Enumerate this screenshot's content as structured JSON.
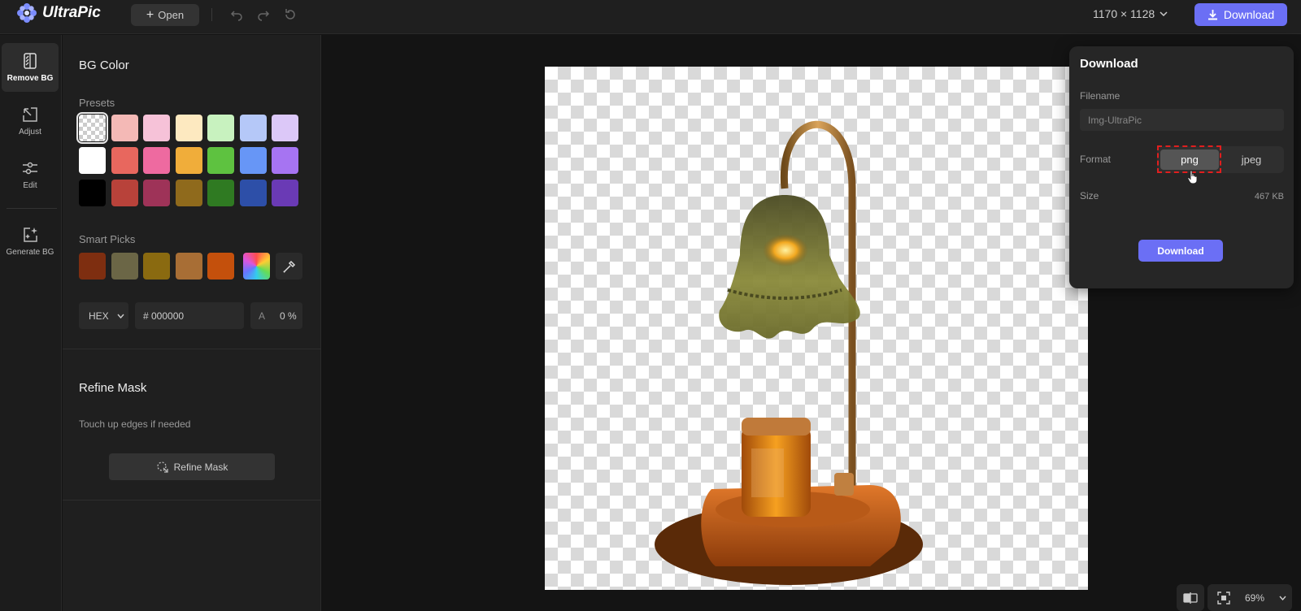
{
  "app": {
    "name": "UltraPic"
  },
  "toolbar": {
    "open_label": "Open",
    "dimensions": "1170 × 1128",
    "download_label": "Download"
  },
  "nav": {
    "items": [
      {
        "label": "Remove BG",
        "icon": "remove-bg-icon",
        "active": true
      },
      {
        "label": "Adjust",
        "icon": "adjust-icon"
      },
      {
        "label": "Edit",
        "icon": "edit-sliders-icon"
      },
      {
        "label": "Generate BG",
        "icon": "generate-bg-icon"
      }
    ]
  },
  "bg_panel": {
    "title": "BG Color",
    "presets_label": "Presets",
    "presets": [
      [
        "transparent",
        "#f4b9b6",
        "#f6c2d8",
        "#fde9c0",
        "#c8f2bf",
        "#b5c8f8",
        "#dcc8f8"
      ],
      [
        "#ffffff",
        "#e8675e",
        "#ee6aa0",
        "#f0ad3a",
        "#5ec240",
        "#6796f6",
        "#a674f2"
      ],
      [
        "#000000",
        "#b8423a",
        "#9e3358",
        "#8f6a1c",
        "#2f7a22",
        "#2d4fa8",
        "#6a3ab5"
      ]
    ],
    "smart_picks_label": "Smart Picks",
    "smart_picks": [
      "#7e2e10",
      "#6b6646",
      "#8a6a10",
      "#a86e35",
      "#c4500c"
    ],
    "format": "HEX",
    "hex_value": "# 000000",
    "alpha_label": "A",
    "alpha_value": "0 %"
  },
  "refine": {
    "title": "Refine Mask",
    "hint": "Touch up edges if needed",
    "button_label": "Refine Mask"
  },
  "download_panel": {
    "title": "Download",
    "filename_label": "Filename",
    "filename_placeholder": "Img-UltraPic",
    "format_label": "Format",
    "formats": [
      "png",
      "jpeg"
    ],
    "selected_format": "png",
    "size_label": "Size",
    "size_value": "467 KB",
    "button_label": "Download"
  },
  "zoom": {
    "value": "69%"
  },
  "colors": {
    "accent": "#6b6ff5",
    "highlight": "#e01e1e"
  }
}
